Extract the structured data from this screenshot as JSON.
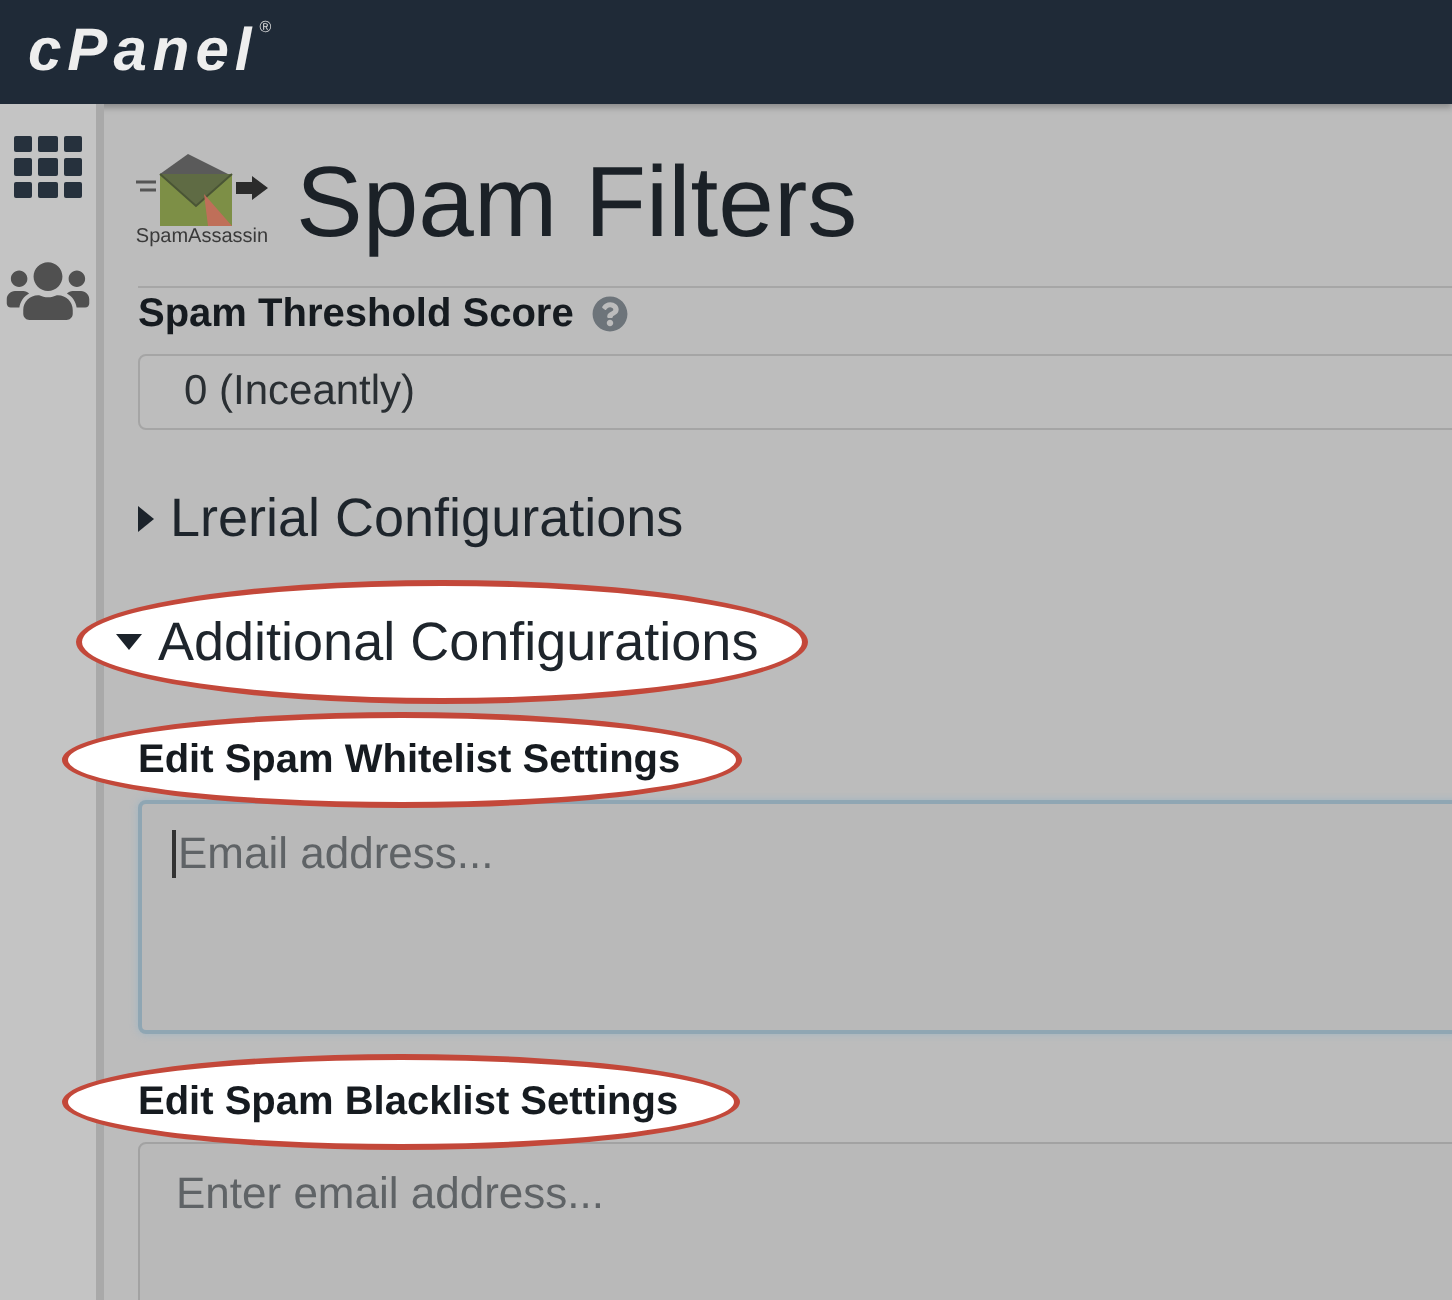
{
  "header": {
    "logo": "cPanel",
    "logo_mark": "®"
  },
  "page": {
    "logo_caption": "SpamAssassin",
    "title": "Spam Filters"
  },
  "threshold": {
    "label": "Spam Threshold Score",
    "value": "0 (Inceantly)"
  },
  "sections": [
    {
      "label": "Lrerial Configurations",
      "expanded": false,
      "highlighted": false
    },
    {
      "label": "Additional Configurations",
      "expanded": true,
      "highlighted": true
    }
  ],
  "lists": [
    {
      "label": "Edit Spam Whitelist Settings",
      "highlighted": true,
      "placeholder": "Email address...",
      "focused": true
    },
    {
      "label": "Edit Spam Blacklist Settings",
      "highlighted": true,
      "placeholder": "Enter email address...",
      "focused": false
    }
  ]
}
